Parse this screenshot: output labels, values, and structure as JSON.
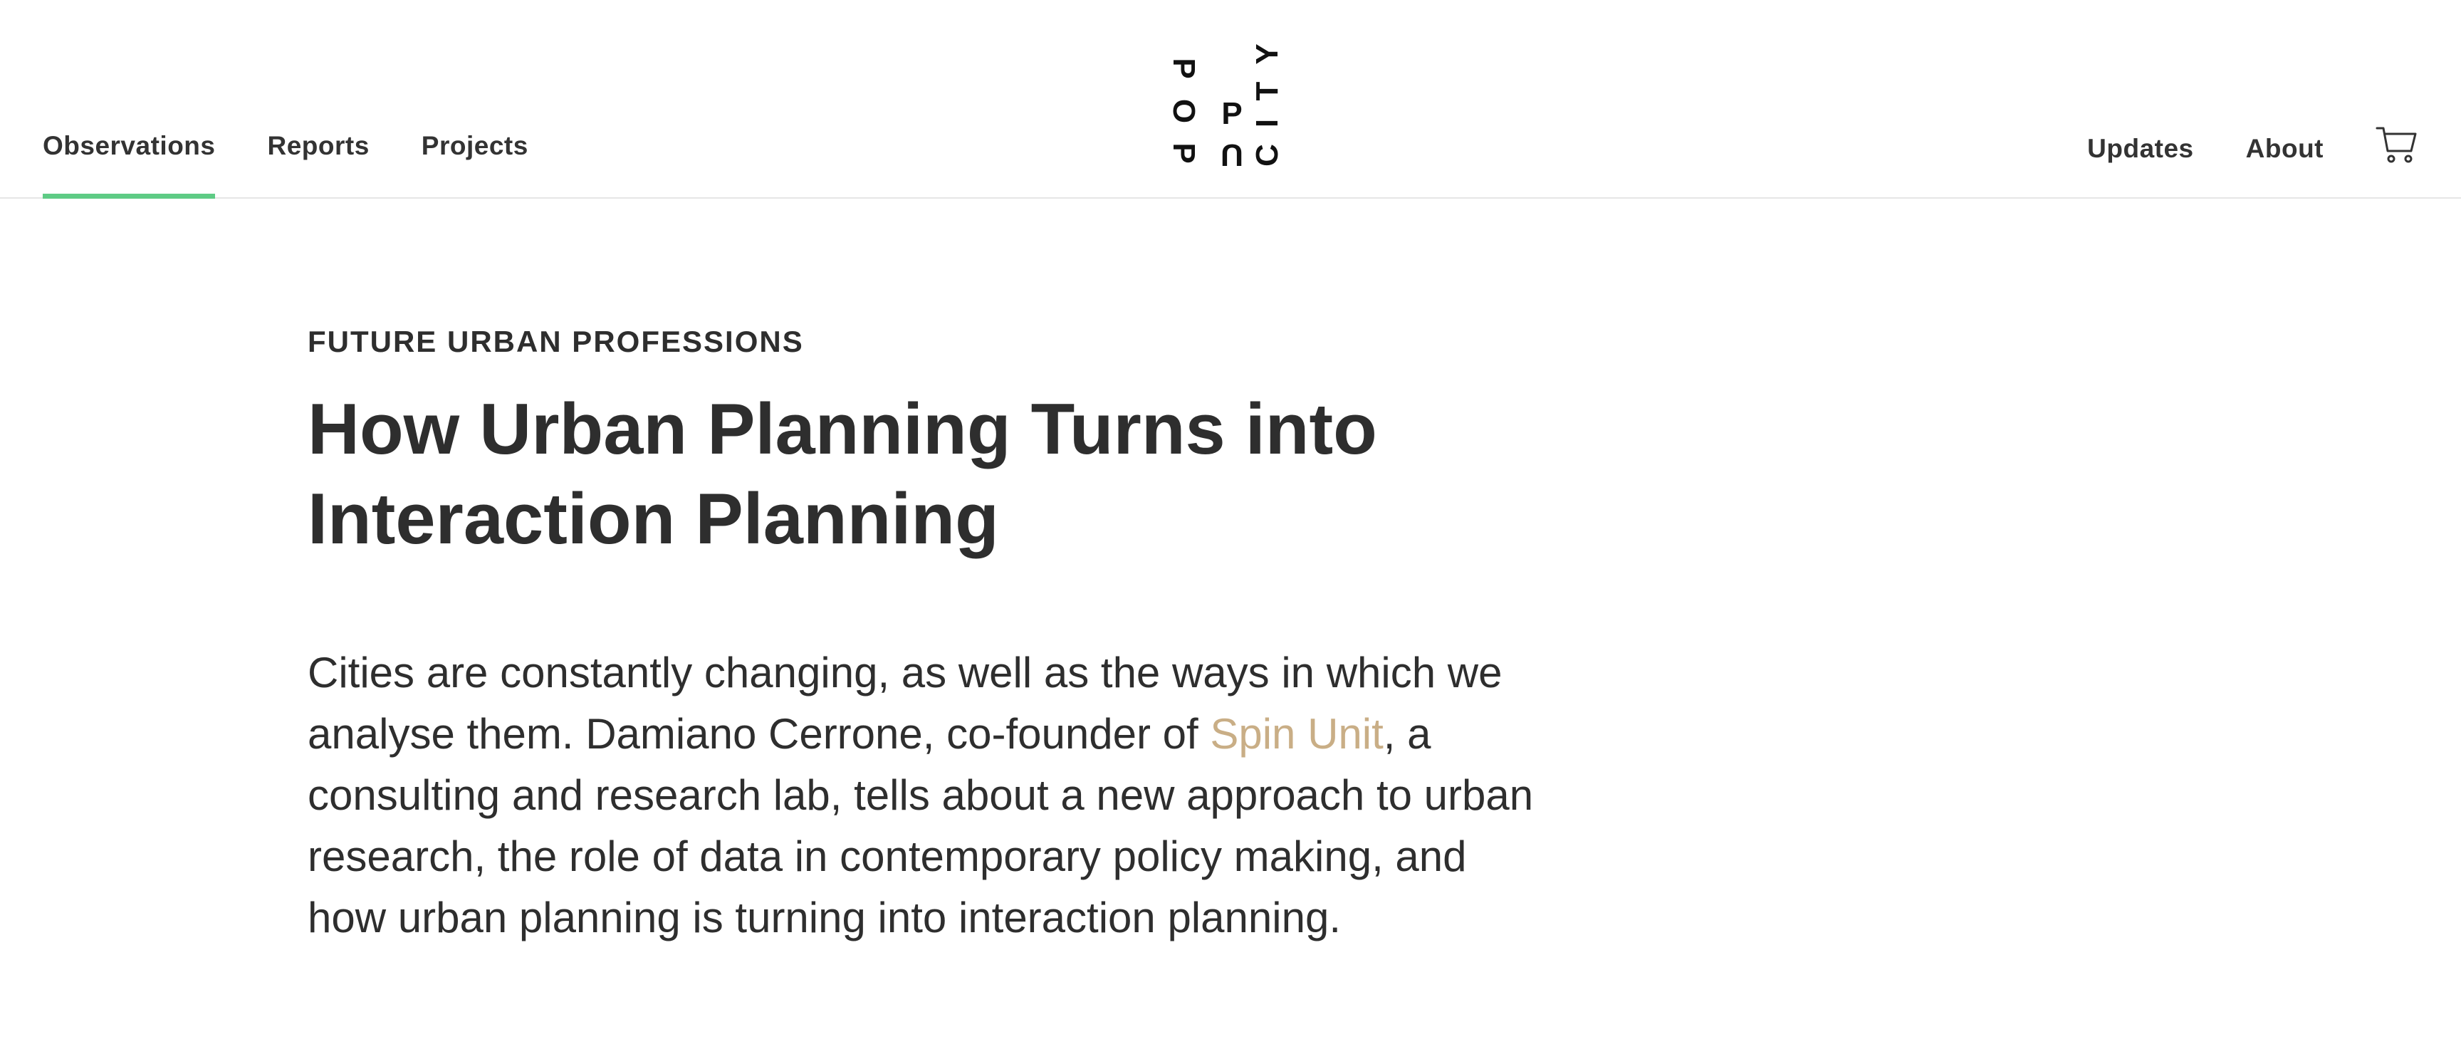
{
  "nav": {
    "left": [
      {
        "label": "Observations",
        "active": true
      },
      {
        "label": "Reports"
      },
      {
        "label": "Projects"
      }
    ],
    "right": [
      {
        "label": "Updates"
      },
      {
        "label": "About"
      }
    ],
    "cart_icon": "cart-icon",
    "active_underline_color": "#5ecb85"
  },
  "logo": {
    "letters": [
      "P",
      "O",
      "P",
      "P",
      "U",
      "C",
      "I",
      "T",
      "Y"
    ]
  },
  "article": {
    "kicker": "FUTURE URBAN PROFESSIONS",
    "title": "How Urban Planning Turns into Interaction Planning",
    "lede_before": "Cities are constantly changing, as well as the ways in which we analyse them. Damiano Cerrone, co-founder of ",
    "lede_link": "Spin Unit",
    "lede_after": ", a consulting and research lab, tells about a new approach to urban research, the role of data in contemporary policy making, and how urban planning is turning into interaction planning.",
    "link_color": "#c9ae86"
  }
}
